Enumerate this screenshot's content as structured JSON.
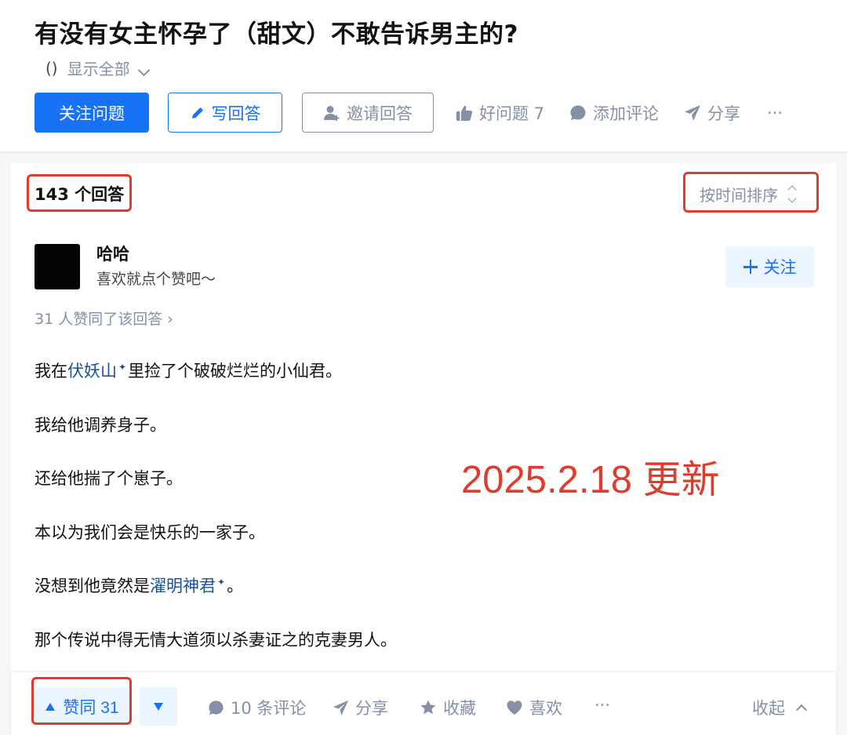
{
  "question": {
    "title": "有没有女主怀孕了（甜文）不敢告诉男主的?",
    "detail_paren": "()",
    "show_all": "显示全部"
  },
  "actions": {
    "follow": "关注问题",
    "write": "写回答",
    "invite": "邀请回答",
    "good_question": "好问题 7",
    "add_comment": "添加评论",
    "share": "分享",
    "more": "···"
  },
  "answers": {
    "count": "143 个回答",
    "sort": "按时间排序"
  },
  "answer": {
    "author": {
      "name": "哈哈",
      "bio": "喜欢就点个赞吧～"
    },
    "follow": "关注",
    "voters": "31 人赞同了该回答 ›",
    "paragraphs": [
      {
        "before": "我在",
        "link": "伏妖山",
        "after": "里捡了个破破烂烂的小仙君。"
      },
      {
        "before": "我给他调养身子。"
      },
      {
        "before": "还给他揣了个崽子。"
      },
      {
        "before": "本以为我们会是快乐的一家子。"
      },
      {
        "before": "没想到他竟然是",
        "link": "濯明神君",
        "after": "。"
      },
      {
        "before": "那个传说中得无情大道须以杀妻证之的克妻男人。"
      }
    ],
    "sparkle": "✦",
    "update_stamp": "2025.2.18 更新"
  },
  "bottom_bar": {
    "upvote": "赞同 31",
    "comments": "10 条评论",
    "share": "分享",
    "collect": "收藏",
    "like": "喜欢",
    "more": "···",
    "collapse": "收起"
  },
  "colors": {
    "brand_blue": "#1772f6",
    "link_blue": "#175199",
    "muted_gray": "#8590a6",
    "annotation_red": "#e03c2d"
  }
}
